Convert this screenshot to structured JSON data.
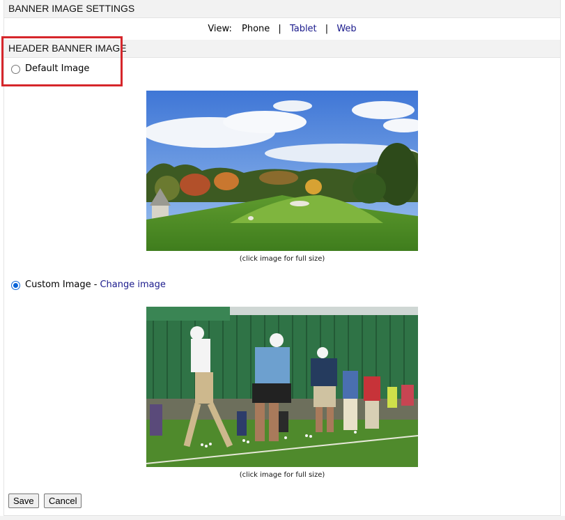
{
  "settings_header": {
    "title": "BANNER IMAGE SETTINGS"
  },
  "view_switcher": {
    "label": "View:",
    "current": "Phone",
    "separator": "|",
    "options": [
      "Tablet",
      "Web"
    ]
  },
  "header_banner": {
    "title": "HEADER BANNER IMAGE",
    "default_option": {
      "label": "Default Image",
      "selected": false
    },
    "default_caption": "(click image for full size)",
    "custom_option": {
      "label": "Custom Image -",
      "link": "Change image",
      "selected": true
    },
    "custom_caption": "(click image for full size)"
  },
  "actions": {
    "save": "Save",
    "cancel": "Cancel"
  },
  "colors": {
    "link": "#1a1a8c",
    "highlight": "#d6262b",
    "radio_checked": "#0a64d8",
    "bar_background": "#f2f2f2"
  }
}
